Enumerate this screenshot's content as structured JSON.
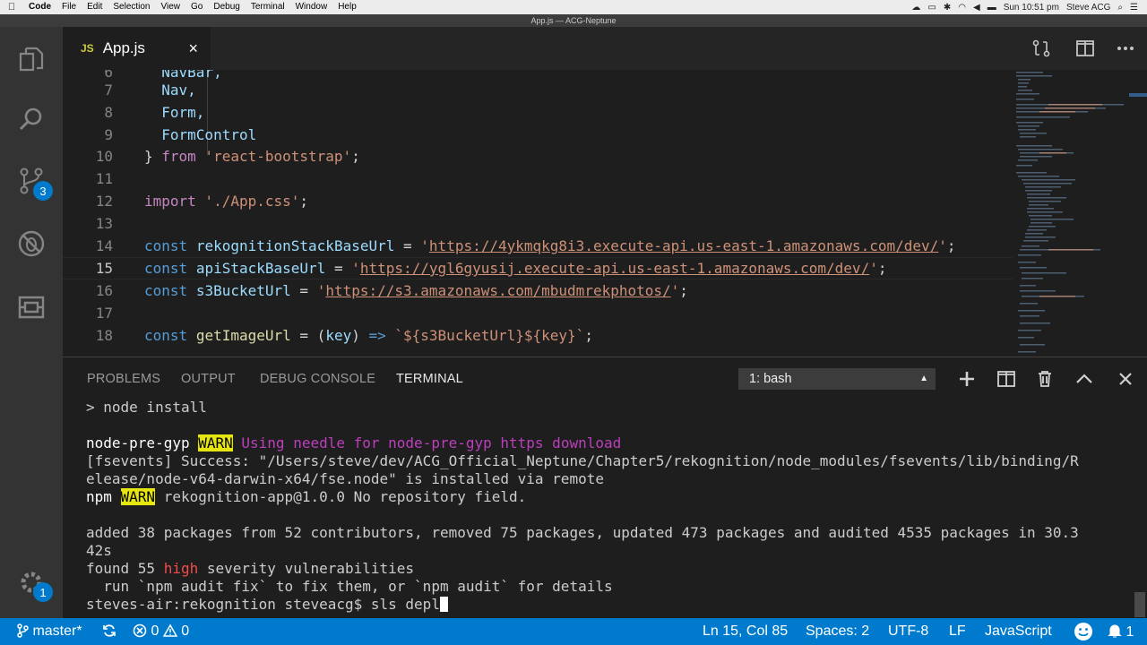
{
  "menubar": {
    "app": "Code",
    "items": [
      "File",
      "Edit",
      "Selection",
      "View",
      "Go",
      "Debug",
      "Terminal",
      "Window",
      "Help"
    ],
    "clock": "Sun 10:51 pm",
    "user": "Steve ACG"
  },
  "window": {
    "title": "App.js — ACG-Neptune"
  },
  "activity": {
    "scm_badge": "3",
    "settings_badge": "1"
  },
  "tab": {
    "lang": "JS",
    "filename": "App.js",
    "close": "×"
  },
  "editor": {
    "lines": [
      {
        "num": "6",
        "text": "  NavBar,"
      },
      {
        "num": "7",
        "text": "  Nav,"
      },
      {
        "num": "8",
        "text": "  Form,"
      },
      {
        "num": "9",
        "text": "  FormControl"
      },
      {
        "num": "10",
        "text_a": "} ",
        "text_b": "from",
        "text_c": " 'react-bootstrap'",
        "text_d": ";"
      },
      {
        "num": "11"
      },
      {
        "num": "12",
        "text_a": "import",
        "text_c": " './App.css'",
        "text_d": ";"
      },
      {
        "num": "13"
      },
      {
        "num": "14",
        "kw": "const",
        "id": "rekognitionStackBaseUrl",
        "eq": " = ",
        "url": "https://4ykmqkg8i3.execute-api.us-east-1.amazonaws.com/dev/",
        "end": ";"
      },
      {
        "num": "15",
        "kw": "const",
        "id": "apiStackBaseUrl",
        "eq": " = ",
        "url": "https://ygl6gyusij.execute-api.us-east-1.amazonaws.com/dev/",
        "end": ";"
      },
      {
        "num": "16",
        "kw": "const",
        "id": "s3BucketUrl",
        "eq": " = ",
        "url": "https://s3.amazonaws.com/mbudmrekphotos/",
        "end": ";"
      },
      {
        "num": "17"
      },
      {
        "num": "18",
        "kw": "const",
        "id": "getImageUrl",
        "rest1": " = (",
        "arg": "key",
        "rest2": ") ",
        "arrow": "=>",
        "tpl": " `${s3BucketUrl}${key}`",
        "end": ";"
      }
    ]
  },
  "panel": {
    "tabs": [
      "PROBLEMS",
      "OUTPUT",
      "DEBUG CONSOLE",
      "TERMINAL"
    ],
    "terminal_select": "1: bash",
    "terminal": {
      "l1": "> node install",
      "l2a": "node-pre-gyp ",
      "l2b": "WARN",
      "l2c": " Using needle for node-pre-gyp https download",
      "l3": "[fsevents] Success: \"/Users/steve/dev/ACG_Official_Neptune/Chapter5/rekognition/node_modules/fsevents/lib/binding/R",
      "l4": "elease/node-v64-darwin-x64/fse.node\" is installed via remote",
      "l5a": "npm ",
      "l5b": "WARN",
      "l5c": " rekognition-app@1.0.0 No repository field.",
      "l6": "added 38 packages from 52 contributors, removed 75 packages, updated 473 packages and audited 4535 packages in 30.3",
      "l7": "42s",
      "l8a": "found 55 ",
      "l8b": "high",
      "l8c": " severity vulnerabilities",
      "l9": "  run `npm audit fix` to fix them, or `npm audit` for details",
      "l10": "steves-air:rekognition steveacg$ sls depl"
    }
  },
  "statusbar": {
    "branch": "master*",
    "errors": "0",
    "warnings": "0",
    "position": "Ln 15, Col 85",
    "spaces": "Spaces: 2",
    "encoding": "UTF-8",
    "eol": "LF",
    "language": "JavaScript",
    "notifications": "1"
  },
  "colors": {
    "status": "#007acc",
    "editor_bg": "#1e1e1e",
    "activity_bg": "#333333"
  }
}
